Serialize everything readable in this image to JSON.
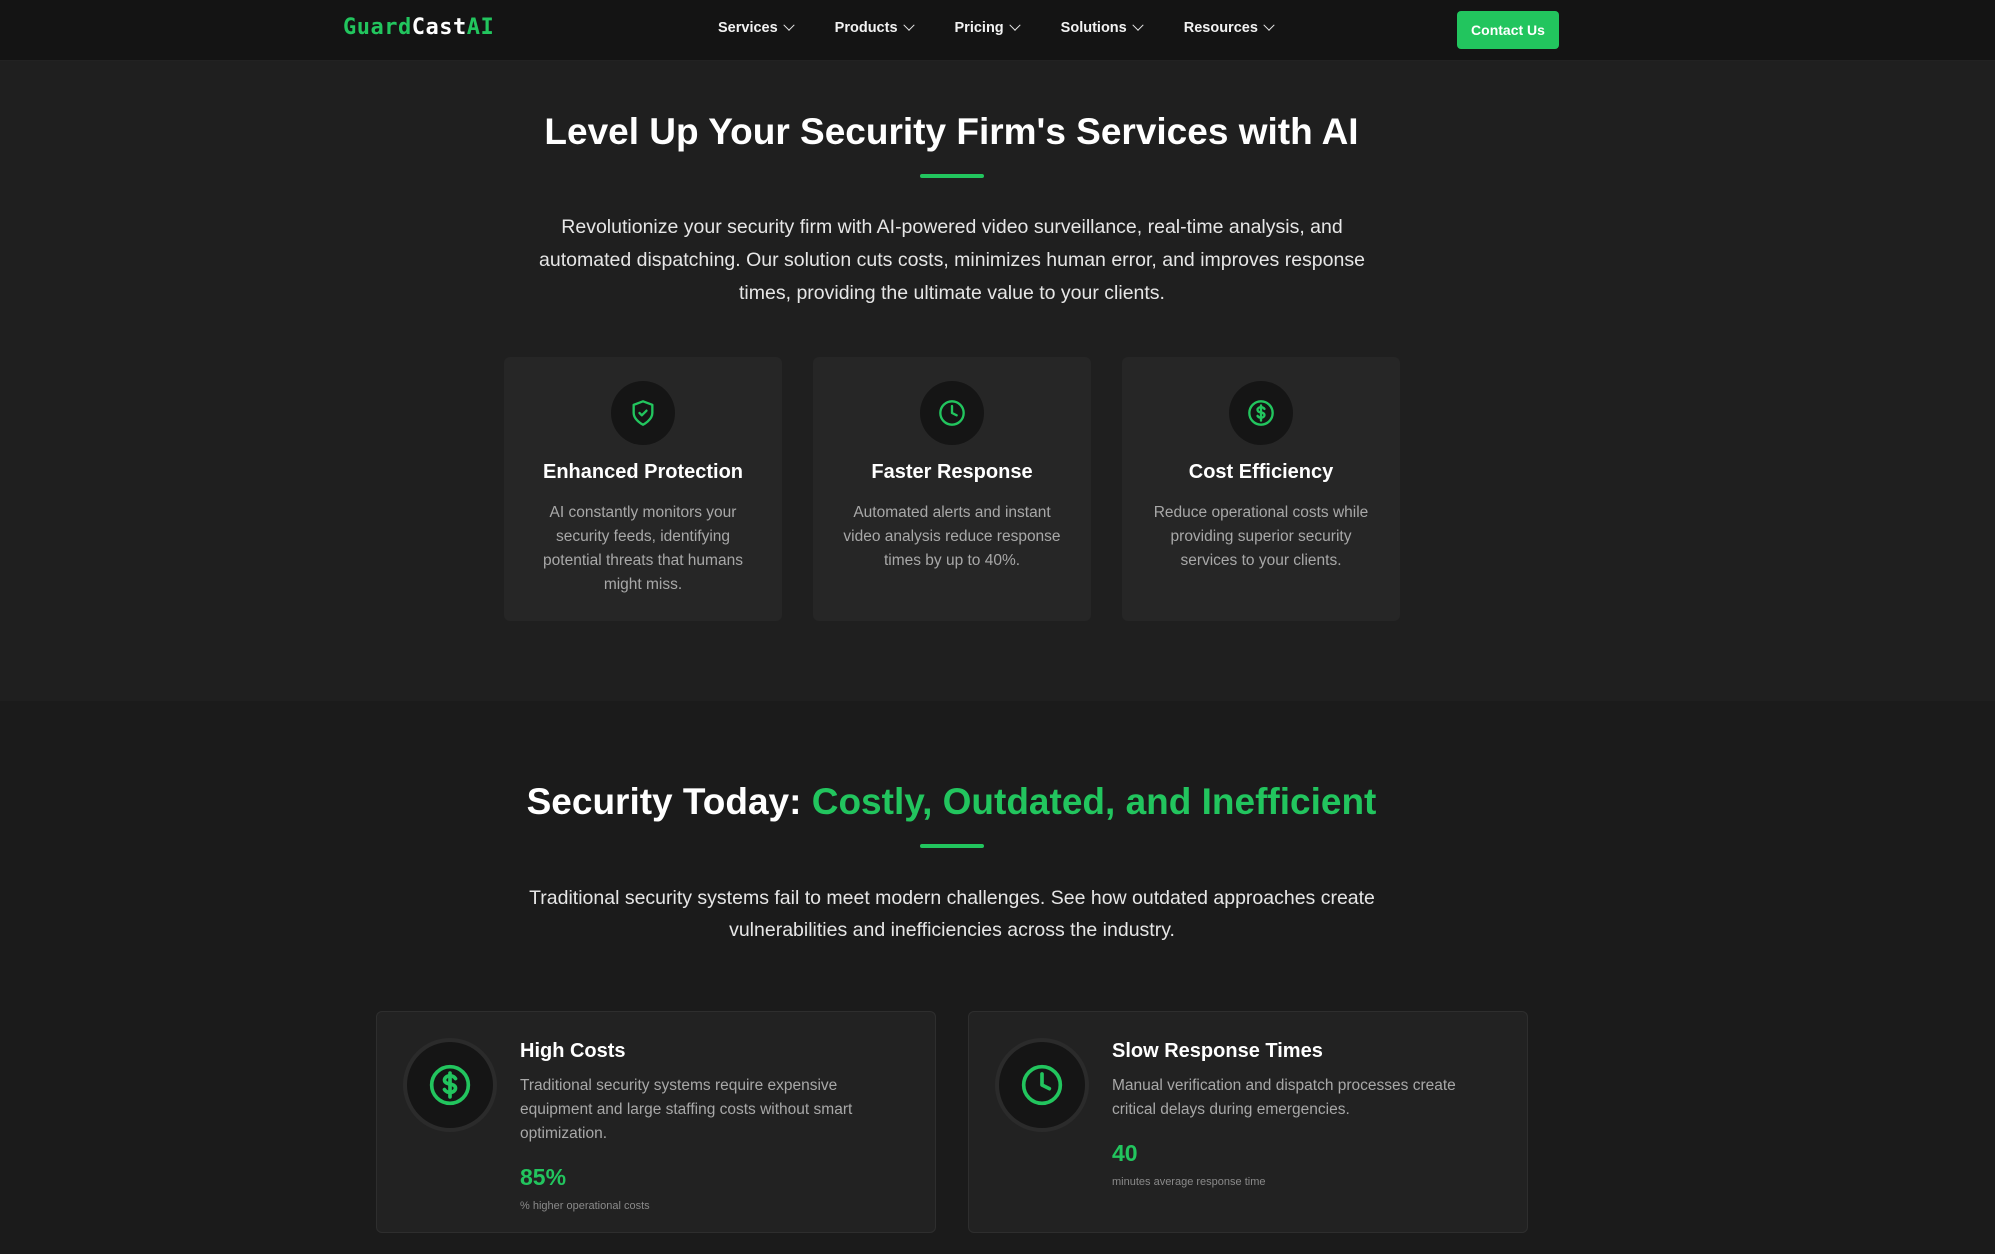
{
  "nav": {
    "logo_part1": "Guard",
    "logo_part2": "Cast",
    "logo_part3": "AI",
    "items": [
      "Services",
      "Products",
      "Pricing",
      "Solutions",
      "Resources"
    ],
    "contact_label": "Contact Us"
  },
  "hero": {
    "title": "Level Up Your Security Firm's Services with AI",
    "description": "Revolutionize your security firm with AI-powered video surveillance, real-time analysis, and automated dispatching. Our solution cuts costs, minimizes human error, and improves response times, providing the ultimate value to your clients.",
    "features": [
      {
        "icon": "shield-check-icon",
        "title": "Enhanced Protection",
        "description": "AI constantly monitors your security feeds, identifying potential threats that humans might miss."
      },
      {
        "icon": "clock-icon",
        "title": "Faster Response",
        "description": "Automated alerts and instant video analysis reduce response times by up to 40%."
      },
      {
        "icon": "dollar-icon",
        "title": "Cost Efficiency",
        "description": "Reduce operational costs while providing superior security services to your clients."
      }
    ]
  },
  "problems": {
    "title_white": "Security Today: ",
    "title_green": "Costly, Outdated, and Inefficient",
    "description": "Traditional security systems fail to meet modern challenges. See how outdated approaches create vulnerabilities and inefficiencies across the industry.",
    "cards": [
      {
        "icon": "dollar-icon",
        "title": "High Costs",
        "description": "Traditional security systems require expensive equipment and large staffing costs without smart optimization.",
        "stat": "85%",
        "stat_label": "% higher operational costs"
      },
      {
        "icon": "clock-icon",
        "title": "Slow Response Times",
        "description": "Manual verification and dispatch processes create critical delays during emergencies.",
        "stat": "40",
        "stat_label": "minutes average response time"
      }
    ]
  },
  "colors": {
    "accent": "#22c55e",
    "background": "#1b1b1b",
    "card": "#262626"
  }
}
